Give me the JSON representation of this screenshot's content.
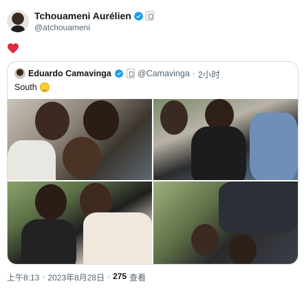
{
  "author": {
    "display_name": "Tchouameni Aurélien",
    "handle": "@atchouameni",
    "verified_icon": "verified-badge-icon",
    "affiliation_icon": "real-madrid-badge-icon"
  },
  "tweet": {
    "content_icon": "red-heart-emoji",
    "accent_color": "#f91880"
  },
  "quoted_tweet": {
    "display_name": "Eduardo Camavinga",
    "handle": "@Camavinga",
    "separator": "·",
    "time_ago": "2小时",
    "text": "South",
    "emoji": "grinning-squinting-face-emoji",
    "photos": [
      "photo-group-1",
      "photo-group-2",
      "photo-group-3",
      "photo-group-4"
    ]
  },
  "footer": {
    "time": "上午8:13",
    "separator": "·",
    "date": "2023年8月28日",
    "separator2": "·",
    "views_count": "275",
    "views_label": "查看"
  },
  "colors": {
    "verified_blue": "#1d9bf0",
    "secondary_text": "#536471",
    "border": "#cfd9de"
  }
}
